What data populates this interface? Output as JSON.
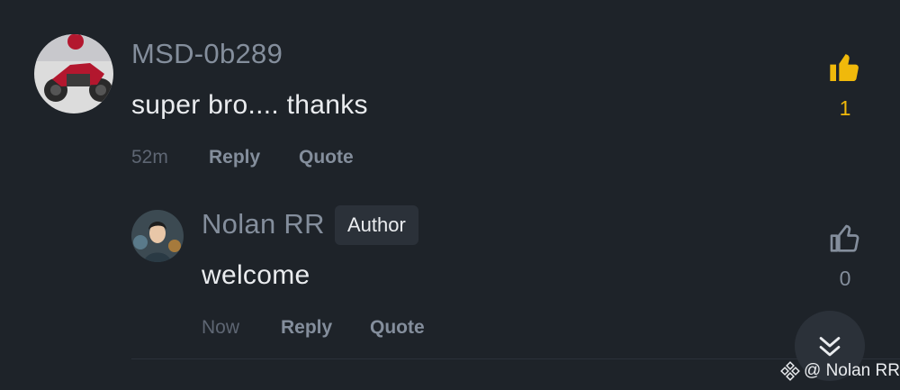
{
  "comments": [
    {
      "username": "MSD-0b289",
      "text": "super bro.... thanks",
      "time": "52m",
      "reply_label": "Reply",
      "quote_label": "Quote",
      "likes": "1",
      "liked": true
    }
  ],
  "reply": {
    "username": "Nolan RR",
    "badge": "Author",
    "text": "welcome",
    "time": "Now",
    "reply_label": "Reply",
    "quote_label": "Quote",
    "likes": "0",
    "liked": false
  },
  "watermark": {
    "text": "@ Nolan RR",
    "icon": "binance-logo-icon"
  },
  "colors": {
    "accent": "#f0b90b",
    "background": "#1e2329",
    "muted": "#848e9c"
  }
}
